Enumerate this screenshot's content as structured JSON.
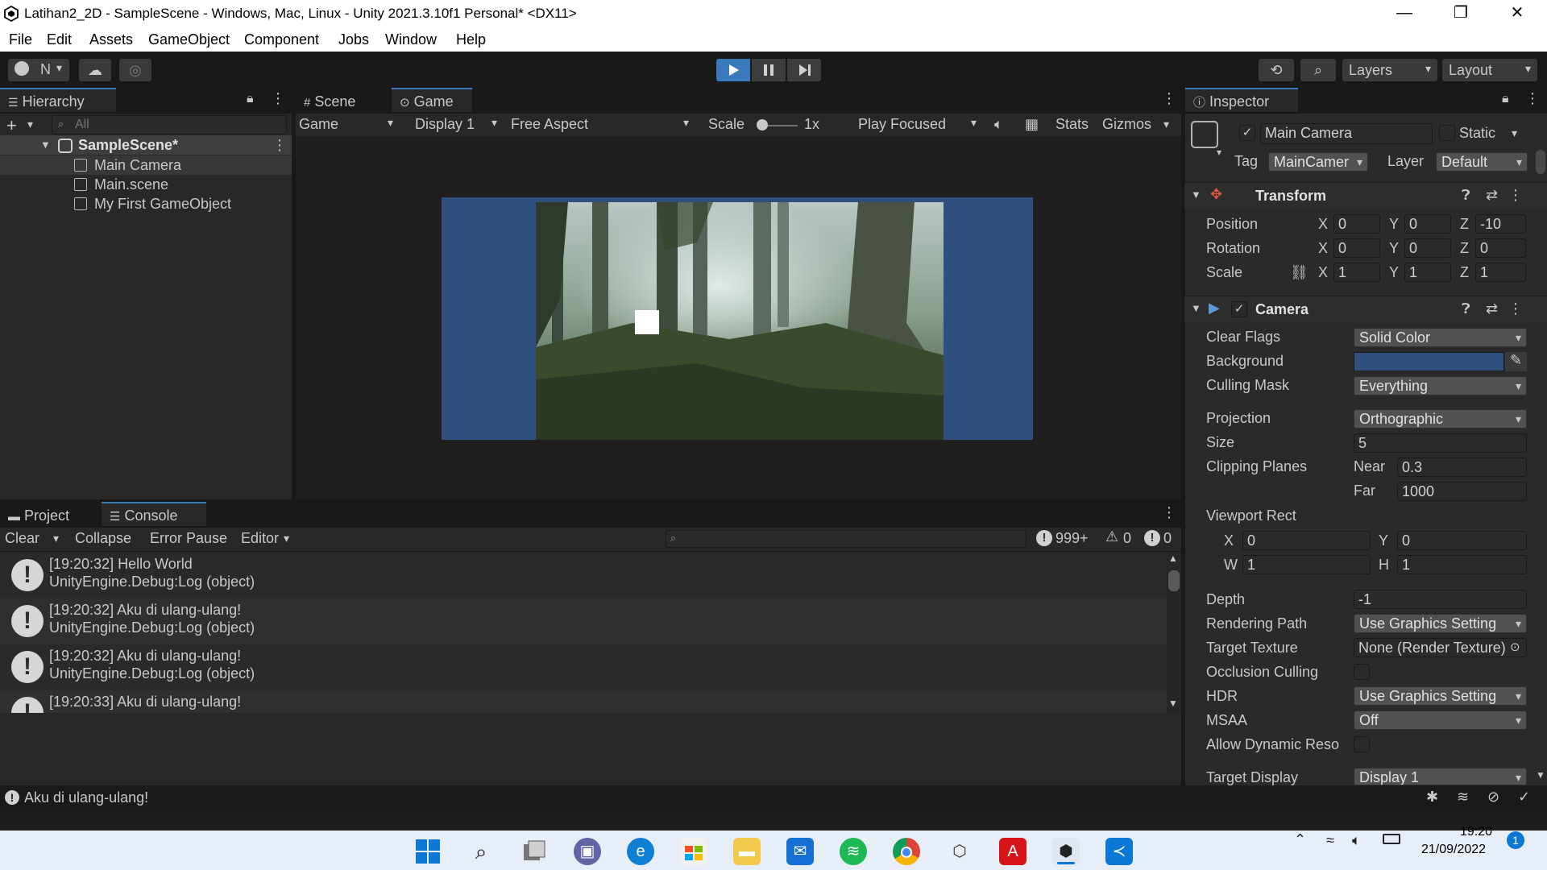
{
  "window": {
    "title": "Latihan2_2D - SampleScene - Windows, Mac, Linux - Unity 2021.3.10f1 Personal* <DX11>",
    "minimize": "—",
    "maximize": "❐",
    "close": "✕"
  },
  "menu": [
    "File",
    "Edit",
    "Assets",
    "GameObject",
    "Component",
    "Jobs",
    "Window",
    "Help"
  ],
  "toolbar": {
    "account": "N",
    "layers": "Layers",
    "layout": "Layout"
  },
  "hierarchy": {
    "tab": "Hierarchy",
    "search_placeholder": "All",
    "scene": "SampleScene*",
    "items": [
      "Main Camera",
      "Main.scene",
      "My First GameObject"
    ]
  },
  "game_view": {
    "tabs": [
      "Scene",
      "Game"
    ],
    "mode": "Game",
    "display": "Display 1",
    "aspect": "Free Aspect",
    "scale_label": "Scale",
    "scale_value": "1x",
    "play_mode": "Play Focused",
    "stats": "Stats",
    "gizmos": "Gizmos",
    "background_color": "#2f4f7f"
  },
  "inspector": {
    "tab": "Inspector",
    "object_name": "Main Camera",
    "static_label": "Static",
    "tag_label": "Tag",
    "tag_value": "MainCamer",
    "layer_label": "Layer",
    "layer_value": "Default",
    "transform": {
      "title": "Transform",
      "position_label": "Position",
      "rotation_label": "Rotation",
      "scale_label": "Scale",
      "position": {
        "x": "0",
        "y": "0",
        "z": "-10"
      },
      "rotation": {
        "x": "0",
        "y": "0",
        "z": "0"
      },
      "scale": {
        "x": "1",
        "y": "1",
        "z": "1"
      }
    },
    "camera": {
      "title": "Camera",
      "clear_flags_label": "Clear Flags",
      "clear_flags": "Solid Color",
      "background_label": "Background",
      "background_color": "#2f4f7f",
      "culling_mask_label": "Culling Mask",
      "culling_mask": "Everything",
      "projection_label": "Projection",
      "projection": "Orthographic",
      "size_label": "Size",
      "size": "5",
      "clipping_label": "Clipping Planes",
      "near_label": "Near",
      "near": "0.3",
      "far_label": "Far",
      "far": "1000",
      "viewport_label": "Viewport Rect",
      "vp_x": "0",
      "vp_y": "0",
      "vp_w": "1",
      "vp_h": "1",
      "depth_label": "Depth",
      "depth": "-1",
      "rendering_path_label": "Rendering Path",
      "rendering_path": "Use Graphics Setting",
      "target_texture_label": "Target Texture",
      "target_texture": "None (Render Texture)",
      "occlusion_label": "Occlusion Culling",
      "hdr_label": "HDR",
      "hdr": "Use Graphics Setting",
      "msaa_label": "MSAA",
      "msaa": "Off",
      "dynamic_res_label": "Allow Dynamic Reso",
      "target_display_label": "Target Display",
      "target_display": "Display 1"
    }
  },
  "console": {
    "tabs": [
      "Project",
      "Console"
    ],
    "clear": "Clear",
    "collapse": "Collapse",
    "error_pause": "Error Pause",
    "editor": "Editor",
    "count_log": "999+",
    "count_warn": "0",
    "count_err": "0",
    "entries": [
      {
        "line1": "[19:20:32] Hello World",
        "line2": "UnityEngine.Debug:Log (object)"
      },
      {
        "line1": "[19:20:32] Aku di ulang-ulang!",
        "line2": "UnityEngine.Debug:Log (object)"
      },
      {
        "line1": "[19:20:32] Aku di ulang-ulang!",
        "line2": "UnityEngine.Debug:Log (object)"
      },
      {
        "line1": "[19:20:33] Aku di ulang-ulang!",
        "line2": ""
      }
    ]
  },
  "status_bar": {
    "message": "Aku di ulang-ulang!"
  },
  "taskbar": {
    "time": "19:20",
    "date": "21/09/2022",
    "notification_count": "1"
  }
}
